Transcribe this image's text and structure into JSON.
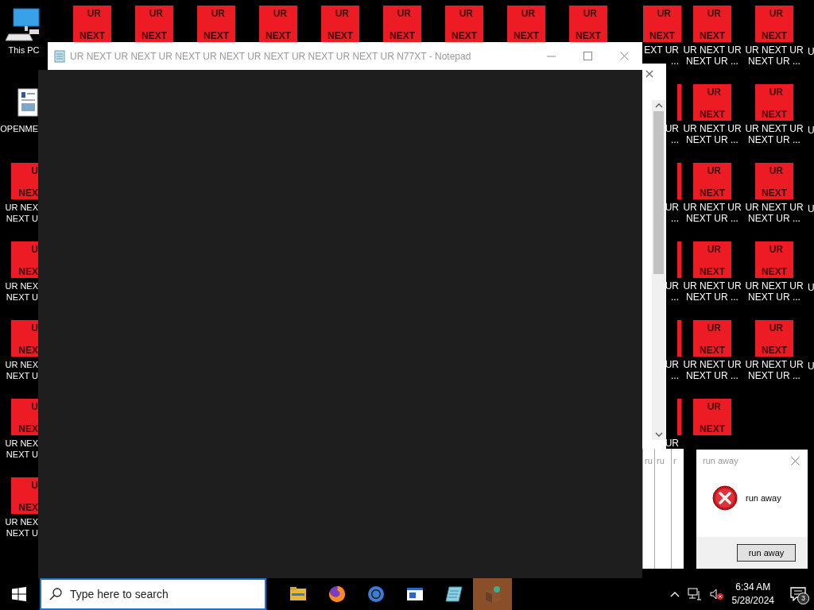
{
  "desktop": {
    "icon_rows": [
      [
        {
          "kind": "pc",
          "label": [
            "This PC"
          ]
        },
        {
          "kind": "red",
          "glyph": [
            "UR",
            "NEXT"
          ]
        },
        {
          "kind": "red",
          "glyph": [
            "UR",
            "NEXT"
          ]
        },
        {
          "kind": "red",
          "glyph": [
            "UR",
            "NEXT"
          ]
        },
        {
          "kind": "red",
          "glyph": [
            "UR",
            "NEXT"
          ]
        },
        {
          "kind": "red",
          "glyph": [
            "UR",
            "NEXT"
          ]
        },
        {
          "kind": "red",
          "glyph": [
            "UR",
            "NEXT"
          ]
        },
        {
          "kind": "red",
          "glyph": [
            "UR",
            "NEXT"
          ]
        },
        {
          "kind": "red",
          "glyph": [
            "UR",
            "NEXT"
          ]
        },
        {
          "kind": "red",
          "glyph": [
            "UR",
            "NEXT"
          ]
        },
        {
          "kind": "red",
          "glyph": [
            "UR",
            "NEXT"
          ],
          "label": [
            "EXT UR",
            "..."
          ]
        },
        {
          "kind": "red",
          "glyph": [
            "UR",
            "NEXT"
          ],
          "label": [
            "UR NEXT UR",
            "NEXT UR ..."
          ]
        },
        {
          "kind": "red",
          "glyph": [
            "UR",
            "NEXT"
          ],
          "label": [
            "UR NEXT UR",
            "NEXT UR ..."
          ]
        },
        {
          "kind": "label",
          "label": [
            "U"
          ]
        }
      ],
      [
        {
          "kind": "document",
          "label": [
            "OPENME"
          ]
        },
        null,
        null,
        null,
        null,
        null,
        null,
        null,
        null,
        null,
        {
          "kind": "red",
          "label": [
            "UR",
            "..."
          ]
        },
        {
          "kind": "red",
          "glyph": [
            "UR",
            "NEXT"
          ],
          "label": [
            "UR NEXT UR",
            "NEXT UR ..."
          ]
        },
        {
          "kind": "red",
          "glyph": [
            "UR",
            "NEXT"
          ],
          "label": [
            "UR NEXT UR",
            "NEXT UR ..."
          ]
        },
        {
          "kind": "label",
          "label": [
            "U"
          ]
        }
      ],
      [
        {
          "kind": "red",
          "glyph": [
            "U",
            "NEX"
          ],
          "label": [
            "UR NEX",
            "NEXT U"
          ]
        },
        null,
        null,
        null,
        null,
        null,
        null,
        null,
        null,
        null,
        {
          "kind": "red",
          "label": [
            "UR",
            "..."
          ]
        },
        {
          "kind": "red",
          "glyph": [
            "UR",
            "NEXT"
          ],
          "label": [
            "UR NEXT UR",
            "NEXT UR ..."
          ]
        },
        {
          "kind": "red",
          "glyph": [
            "UR",
            "NEXT"
          ],
          "label": [
            "UR NEXT UR",
            "NEXT UR ..."
          ]
        },
        {
          "kind": "label",
          "label": [
            "U"
          ]
        }
      ],
      [
        {
          "kind": "red",
          "glyph": [
            "U",
            "NEX"
          ],
          "label": [
            "UR NEX",
            "NEXT U"
          ]
        },
        null,
        null,
        null,
        null,
        null,
        null,
        null,
        null,
        null,
        {
          "kind": "red",
          "label": [
            "UR",
            "..."
          ]
        },
        {
          "kind": "red",
          "glyph": [
            "UR",
            "NEXT"
          ],
          "label": [
            "UR NEXT UR",
            "NEXT UR ..."
          ]
        },
        {
          "kind": "red",
          "glyph": [
            "UR",
            "NEXT"
          ],
          "label": [
            "UR NEXT UR",
            "NEXT UR ..."
          ]
        },
        {
          "kind": "label",
          "label": [
            "U"
          ]
        }
      ],
      [
        {
          "kind": "red",
          "glyph": [
            "U",
            "NEX"
          ],
          "label": [
            "UR NEX",
            "NEXT U"
          ]
        },
        null,
        null,
        null,
        null,
        null,
        null,
        null,
        null,
        null,
        {
          "kind": "red",
          "label": [
            "UR",
            "..."
          ]
        },
        {
          "kind": "red",
          "glyph": [
            "UR",
            "NEXT"
          ],
          "label": [
            "UR NEXT UR",
            "NEXT UR ..."
          ]
        },
        {
          "kind": "red",
          "glyph": [
            "UR",
            "NEXT"
          ],
          "label": [
            "UR NEXT UR",
            "NEXT UR ..."
          ]
        },
        {
          "kind": "label",
          "label": [
            "U"
          ]
        }
      ],
      [
        {
          "kind": "red",
          "glyph": [
            "U",
            "NEX"
          ],
          "label": [
            "UR NEX",
            "NEXT U"
          ]
        },
        null,
        null,
        null,
        null,
        null,
        null,
        null,
        null,
        null,
        {
          "kind": "red",
          "label": [
            "UR"
          ]
        },
        {
          "kind": "red",
          "glyph": [
            "UR",
            "NEXT"
          ]
        },
        null,
        null
      ],
      [
        {
          "kind": "red",
          "glyph": [
            "U",
            "NEX"
          ],
          "label": [
            "UR NEX",
            "NEXT U"
          ]
        },
        null,
        null,
        null,
        null,
        null,
        null,
        null,
        null,
        null,
        null,
        null,
        null,
        null
      ]
    ]
  },
  "notepad": {
    "title": "UR NEXT UR NEXT UR NEXT UR NEXT UR NEXT UR NEXT UR NEXT UR N77XT - Notepad",
    "active": false
  },
  "stacked_dialogs": [
    {
      "title": "ru"
    },
    {
      "title": "ru"
    },
    {
      "title": "r"
    }
  ],
  "dialog": {
    "title": "run away",
    "message": "run away",
    "button": "run away"
  },
  "taskbar": {
    "search": {
      "placeholder": "Type here to search"
    },
    "apps": [
      {
        "kind": "folder",
        "selected": false
      },
      {
        "kind": "firefox",
        "selected": false
      },
      {
        "kind": "ring",
        "selected": false
      },
      {
        "kind": "window",
        "selected": false
      },
      {
        "kind": "notepad",
        "selected": false
      },
      {
        "kind": "box",
        "selected": true
      }
    ],
    "clock": {
      "time": "6:34 AM",
      "date": "5/28/2024"
    },
    "notifications": {
      "count": "3"
    }
  }
}
